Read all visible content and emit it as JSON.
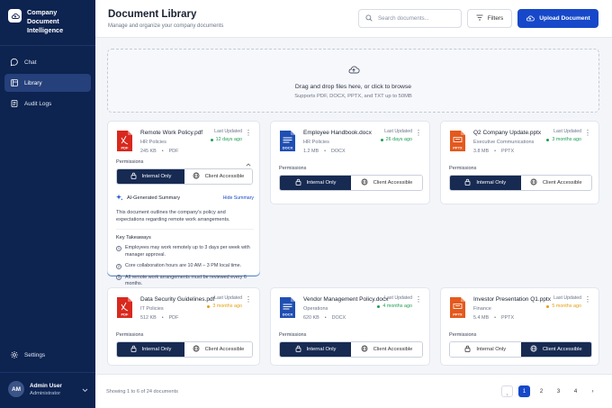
{
  "brand": {
    "name": "Company Document Intelligence"
  },
  "nav": [
    {
      "label": "Chat",
      "icon": "chat-icon",
      "active": false
    },
    {
      "label": "Library",
      "icon": "library-icon",
      "active": true
    },
    {
      "label": "Audit Logs",
      "icon": "audit-logs-icon",
      "active": false
    }
  ],
  "settings_label": "Settings",
  "user": {
    "initials": "AM",
    "name": "Admin User",
    "role": "Administrator"
  },
  "header": {
    "title": "Document Library",
    "subtitle": "Manage and organize your company documents",
    "search_placeholder": "Search documents...",
    "filters_label": "Filters",
    "upload_label": "Upload Document"
  },
  "dropzone": {
    "title": "Drag and drop files here, or click to browse",
    "subtitle": "Supports PDF, DOCX, PPTX, and TXT up to 50MB"
  },
  "colors": {
    "brand": "#0d2350",
    "accent": "#1748c9",
    "pdf": "#d9281e",
    "docx": "#1f4fb3",
    "pptx": "#e4591d",
    "recent": "#1f9d55",
    "older": "#e0a012"
  },
  "cards": [
    {
      "name": "Remote Work Policy.pdf",
      "category": "HR Policies",
      "size": "245 KB",
      "type": "PDF",
      "icon": "pdf-file-icon",
      "last_updated_label": "Last Updated",
      "updated": "12 days ago",
      "status": "recent",
      "permissions_label": "Permissions",
      "internal_label": "Internal Only",
      "client_label": "Client Accessible",
      "selected": "internal",
      "expanded": true
    },
    {
      "name": "Employee Handbook.docx",
      "category": "HR Policies",
      "size": "1.2 MB",
      "type": "DOCX",
      "icon": "docx-file-icon",
      "last_updated_label": "Last Updated",
      "updated": "26 days ago",
      "status": "recent",
      "permissions_label": "Permissions",
      "internal_label": "Internal Only",
      "client_label": "Client Accessible",
      "selected": "internal"
    },
    {
      "name": "Q2 Company Update.pptx",
      "category": "Executive Communications",
      "size": "3.8 MB",
      "type": "PPTX",
      "icon": "pptx-file-icon",
      "last_updated_label": "Last Updated",
      "updated": "3 months ago",
      "status": "recent",
      "permissions_label": "Permissions",
      "internal_label": "Internal Only",
      "client_label": "Client Accessible",
      "selected": "internal"
    },
    {
      "name": "Data Security Guidelines.pdf",
      "category": "IT Policies",
      "size": "512 KB",
      "type": "PDF",
      "icon": "pdf-file-icon",
      "last_updated_label": "Last Updated",
      "updated": "3 months ago",
      "status": "older",
      "permissions_label": "Permissions",
      "internal_label": "Internal Only",
      "client_label": "Client Accessible",
      "selected": "internal"
    },
    {
      "name": "Vendor Management Policy.docx",
      "category": "Operations",
      "size": "620 KB",
      "type": "DOCX",
      "icon": "docx-file-icon",
      "last_updated_label": "Last Updated",
      "updated": "4 months ago",
      "status": "recent",
      "permissions_label": "Permissions",
      "internal_label": "Internal Only",
      "client_label": "Client Accessible",
      "selected": "internal"
    },
    {
      "name": "Investor Presentation Q1.pptx",
      "category": "Finance",
      "size": "5.4 MB",
      "type": "PPTX",
      "icon": "pptx-file-icon",
      "last_updated_label": "Last Updated",
      "updated": "5 months ago",
      "status": "older",
      "permissions_label": "Permissions",
      "internal_label": "Internal Only",
      "client_label": "Client Accessible",
      "selected": "client"
    }
  ],
  "summary": {
    "title": "AI-Generated Summary",
    "hide_label": "Hide Summary",
    "text": "This document outlines the company's policy and expectations regarding remote work arrangements.",
    "takeaways_label": "Key Takeaways",
    "takeaways": [
      "Employees may work remotely up to 3 days per week with manager approval.",
      "Core collaboration hours are 10 AM – 3 PM local time.",
      "All remote work arrangements must be reviewed every 6 months."
    ]
  },
  "footer": {
    "showing": "Showing 1 to 6 of 24 documents",
    "pages": [
      "1",
      "2",
      "3",
      "4"
    ],
    "current_page": "1"
  }
}
